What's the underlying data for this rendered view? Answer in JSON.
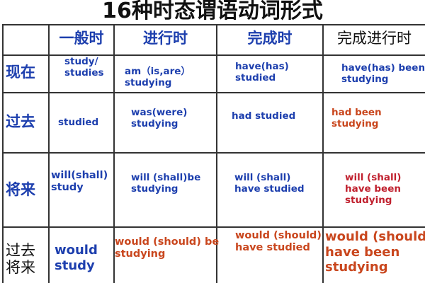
{
  "title": "16种时态谓语动词形式",
  "headers": [
    "一般时",
    "进行时",
    "完成时",
    "完成进行时"
  ],
  "rows": [
    {
      "label": "现在",
      "cells": [
        "study/\nstudies",
        "am（is,are）\nstudying",
        "have(has)\nstudied",
        "have(has) been\nstudying"
      ]
    },
    {
      "label": "过去",
      "cells": [
        "studied",
        "was(were)\nstudying",
        "had studied",
        "had been\nstudying"
      ]
    },
    {
      "label": "将来",
      "cells": [
        "will(shall)\nstudy",
        "will (shall)be\nstudying",
        "will (shall)\nhave studied",
        "will (shall)\nhave been\nstudying"
      ]
    },
    {
      "label": "过去\n将来",
      "cells": [
        "would\nstudy",
        "would (should) be\nstudying",
        "would (should)\nhave studied",
        "would (should)\nhave been\nstudying"
      ]
    }
  ],
  "colors": {
    "blue": "#1d3fae",
    "orange": "#c9461d",
    "red": "#c0202e",
    "black": "#111111"
  }
}
